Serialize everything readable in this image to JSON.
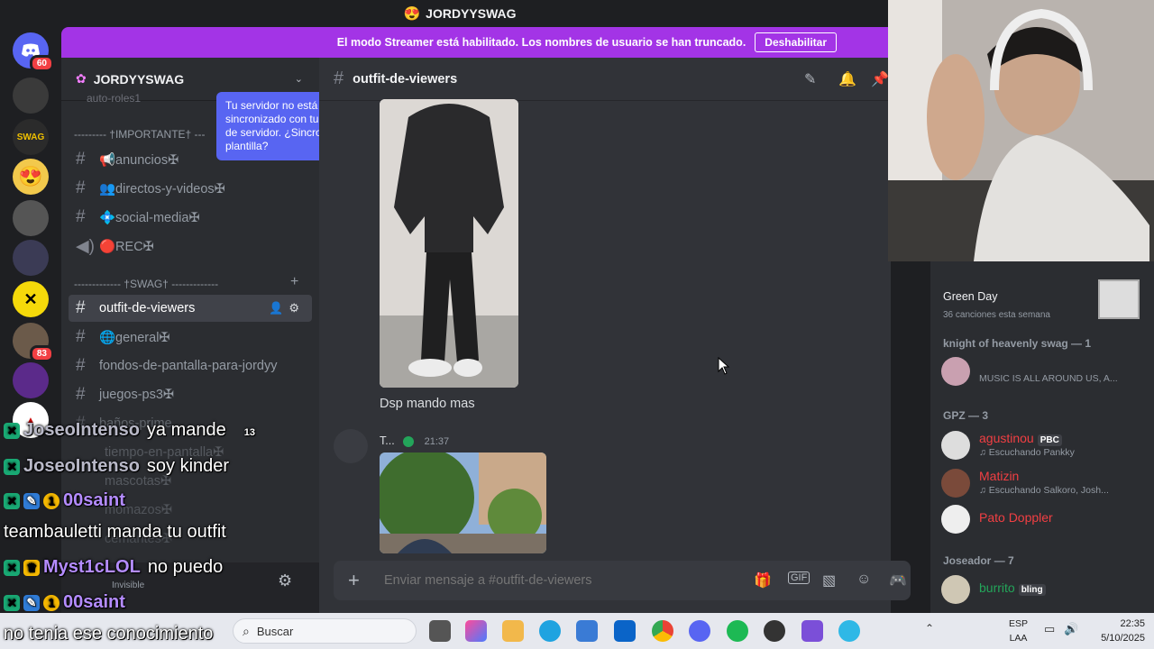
{
  "window": {
    "title": "JORDYYSWAG",
    "title_emoji": "😍"
  },
  "banner": {
    "message": "El modo Streamer está habilitado. Los nombres de usuario se han truncado.",
    "button": "Deshabilitar"
  },
  "rail": {
    "badges": [
      "60",
      "83"
    ],
    "server_label": "SWAG"
  },
  "server": {
    "name": "JORDYYSWAG",
    "cut_channel": "auto-roles1"
  },
  "tooltip": {
    "text": "Tu servidor no está sincronizado con tu plantilla de servidor. ¿Sincronizar plantilla?"
  },
  "categories": {
    "importante": "--------- †IMPORTANTE† ---",
    "swag": "------------- †SWAG† -------------"
  },
  "channels": [
    {
      "name": "📢anuncios✠"
    },
    {
      "name": "👥directos-y-videos✠"
    },
    {
      "name": "💠social-media✠"
    },
    {
      "name": "🔴REC✠"
    },
    {
      "name": "outfit-de-viewers"
    },
    {
      "name": "🌐general✠"
    },
    {
      "name": "fondos-de-pantalla-para-jordyy"
    },
    {
      "name": "juegos-ps3✠"
    },
    {
      "name": "baños-prime"
    },
    {
      "name": "tiempo-en-pantalla✠"
    },
    {
      "name": "mascotas✠"
    },
    {
      "name": "momazos✠"
    },
    {
      "name": "cemantes✠"
    }
  ],
  "chat": {
    "channel": "outfit-de-viewers",
    "message_text": "Dsp mando mas",
    "author2": "T...",
    "time2": "21:37",
    "composer_placeholder": "Enviar mensaje a #outfit-de-viewers"
  },
  "members": {
    "activity": {
      "artist": "Green Day",
      "sub": "36 canciones esta semana"
    },
    "group1": "knight of heavenly swag — 1",
    "g1_user_sub": "MUSIC IS ALL AROUND US, A...",
    "group2": "GPZ — 3",
    "group3": "Joseador — 7",
    "rows": [
      {
        "name": "agustinou",
        "tag": "PBC",
        "sub": "♫ Escuchando Pankky",
        "color": "#f23f43"
      },
      {
        "name": "Matizin",
        "tag": "",
        "sub": "♫ Escuchando Salkoro, Josh...",
        "color": "#f23f43"
      },
      {
        "name": "Pato Doppler",
        "tag": "",
        "sub": "",
        "color": "#f23f43"
      },
      {
        "name": "burrito",
        "tag": "bling",
        "sub": "",
        "color": "#23a55a"
      }
    ]
  },
  "stream_chat": [
    {
      "user": "JoseoIntenso",
      "msg": "ya mande",
      "extra": "13"
    },
    {
      "user": "JoseoIntenso",
      "msg": "soy kinder"
    },
    {
      "user": "00saint",
      "msg": ""
    },
    {
      "user": "",
      "msg": "teambauletti manda tu outfit"
    },
    {
      "user": "Myst1cLOL",
      "msg": "no puedo"
    },
    {
      "user": "00saint",
      "msg": ""
    },
    {
      "user": "",
      "msg": "no tenia ese conocimiento"
    }
  ],
  "status_label": "Invisible",
  "taskbar": {
    "search": "Buscar",
    "lang1": "ESP",
    "lang2": "LAA",
    "time": "22:35",
    "date": "5/10/2025"
  },
  "colors": {
    "banner": "#a334e6",
    "tooltip": "#5865f2",
    "accent_red": "#f23f43",
    "online": "#23a55a"
  }
}
